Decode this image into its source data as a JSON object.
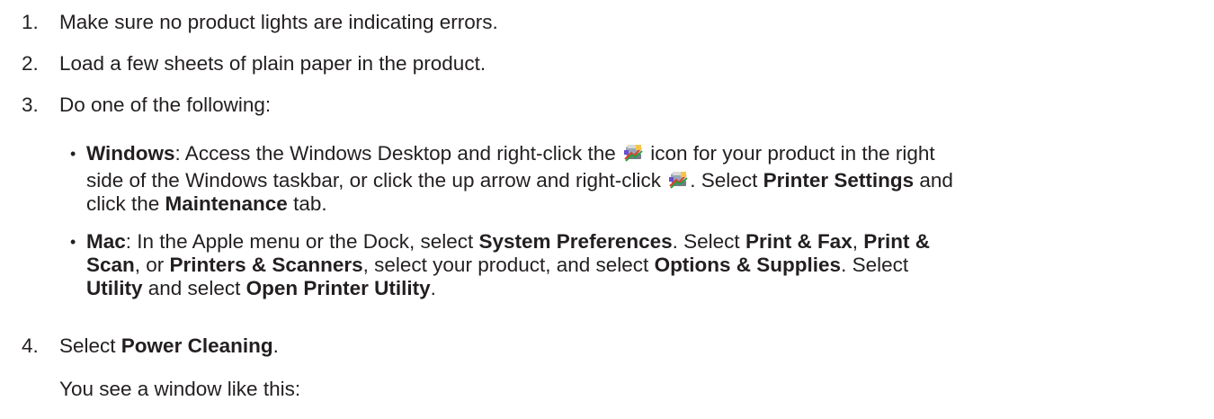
{
  "steps": [
    {
      "num": "1.",
      "text": "Make sure no product lights are indicating errors."
    },
    {
      "num": "2.",
      "text": "Load a few sheets of plain paper in the product."
    },
    {
      "num": "3.",
      "text": "Do one of the following:"
    },
    {
      "num": "4.",
      "text_pre": "Select ",
      "bold": "Power Cleaning",
      "text_post": "."
    }
  ],
  "windows_bullet": {
    "dot": "•",
    "label": "Windows",
    "l1_a": ": Access the Windows Desktop and right-click the ",
    "l1_b": " icon for your product in the right",
    "l2_a": "side of the Windows taskbar, or click the up arrow and right-click ",
    "l2_b": ". Select ",
    "l2_bold": "Printer Settings",
    "l2_c": " and",
    "l3_a": "click the ",
    "l3_bold": "Maintenance",
    "l3_b": " tab.",
    "icon": "printer-tray-icon"
  },
  "mac_bullet": {
    "dot": "•",
    "label": "Mac",
    "l1_a": ": In the Apple menu or the Dock, select ",
    "l1_bold1": "System Preferences",
    "l1_b": ". Select ",
    "l1_bold2": "Print & Fax",
    "l1_c": ", ",
    "l1_bold3": "Print &",
    "l2_bold1": "Scan",
    "l2_a": ", or ",
    "l2_bold2": "Printers & Scanners",
    "l2_b": ", select your product, and select ",
    "l2_bold3": "Options & Supplies",
    "l2_c": ". Select",
    "l3_bold1": "Utility",
    "l3_a": " and select ",
    "l3_bold2": "Open Printer Utility",
    "l3_b": "."
  },
  "after_step4": "You see a window like this:"
}
